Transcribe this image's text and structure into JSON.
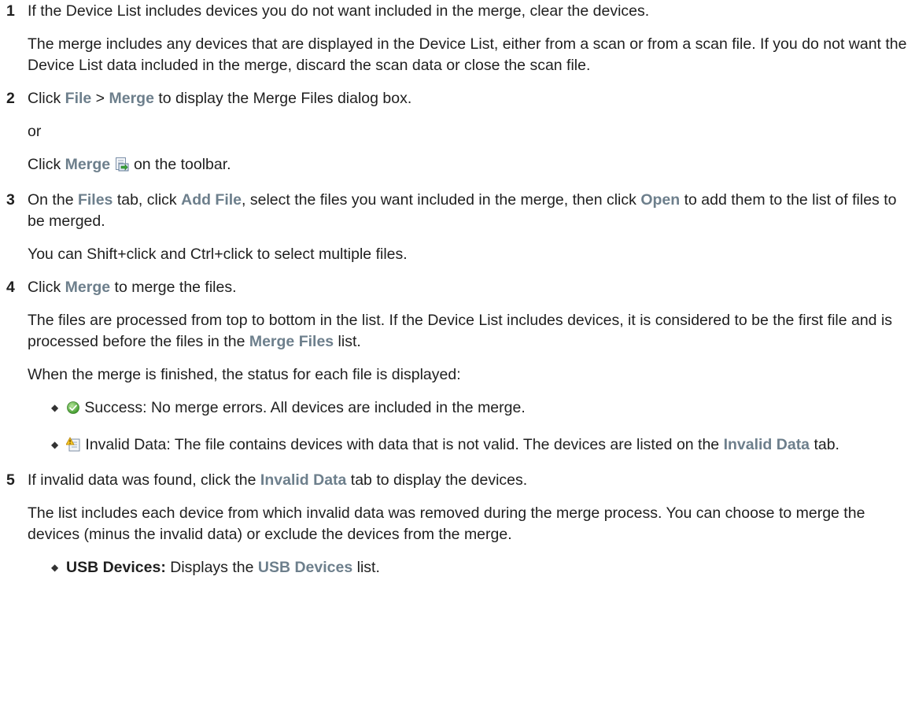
{
  "steps": [
    {
      "num": "1",
      "text": "If the Device List includes devices you do not want included in the merge, clear the devices.",
      "para": "The merge includes any devices that are displayed in the Device List, either from a scan or from a scan file. If you do not want the Device List data included in the merge, discard the scan data or close the scan file."
    },
    {
      "num": "2",
      "t1": "Click ",
      "file": "File",
      "sep": " > ",
      "merge": "Merge",
      "t2": " to display the Merge Files dialog box.",
      "or": "or",
      "c1": "Click ",
      "merge_btn": "Merge",
      "c2": " on the toolbar."
    },
    {
      "num": "3",
      "t1": "On the ",
      "files_tab": "Files",
      "t2": " tab, click ",
      "add_file": "Add File",
      "t3": ", select the files you want included in the merge, then click ",
      "open": "Open",
      "t4": " to add them to the list of files to be merged.",
      "para": "You can Shift+click and Ctrl+click to select multiple files."
    },
    {
      "num": "4",
      "t1": "Click ",
      "merge": "Merge",
      "t2": " to merge the files.",
      "para_a": "The files are processed from top to bottom in the list. If the Device List includes devices, it is considered to be the first file and is processed before the files in the ",
      "merge_files": "Merge Files",
      "para_b": " list.",
      "para2": "When the merge is finished, the status for each file is displayed:",
      "bullets": [
        {
          "text": " Success: No merge errors. All devices are included in the merge."
        },
        {
          "text_a": " Invalid Data: The file contains devices with data that is not valid. The devices are listed on the ",
          "link": "Invalid Data",
          "text_b": " tab."
        }
      ]
    },
    {
      "num": "5",
      "t1": "If invalid data was found, click the ",
      "invalid_data": "Invalid Data",
      "t2": " tab to display the devices.",
      "para": "The list includes each device from which invalid data was removed during the merge process. You can choose to merge the devices (minus the invalid data) or exclude the devices from the merge.",
      "bullets": [
        {
          "label": "USB Devices:",
          "text_a": " Displays the ",
          "link": "USB Devices",
          "text_b": " list."
        }
      ]
    }
  ],
  "colors": {
    "ui_term": "#6d7f8c",
    "body_text": "#1f1f1f"
  },
  "icons": {
    "merge": "merge-toolbar-icon",
    "success": "success-check-icon",
    "invalid": "invalid-data-warning-icon",
    "bullet": "diamond-bullet-icon"
  }
}
